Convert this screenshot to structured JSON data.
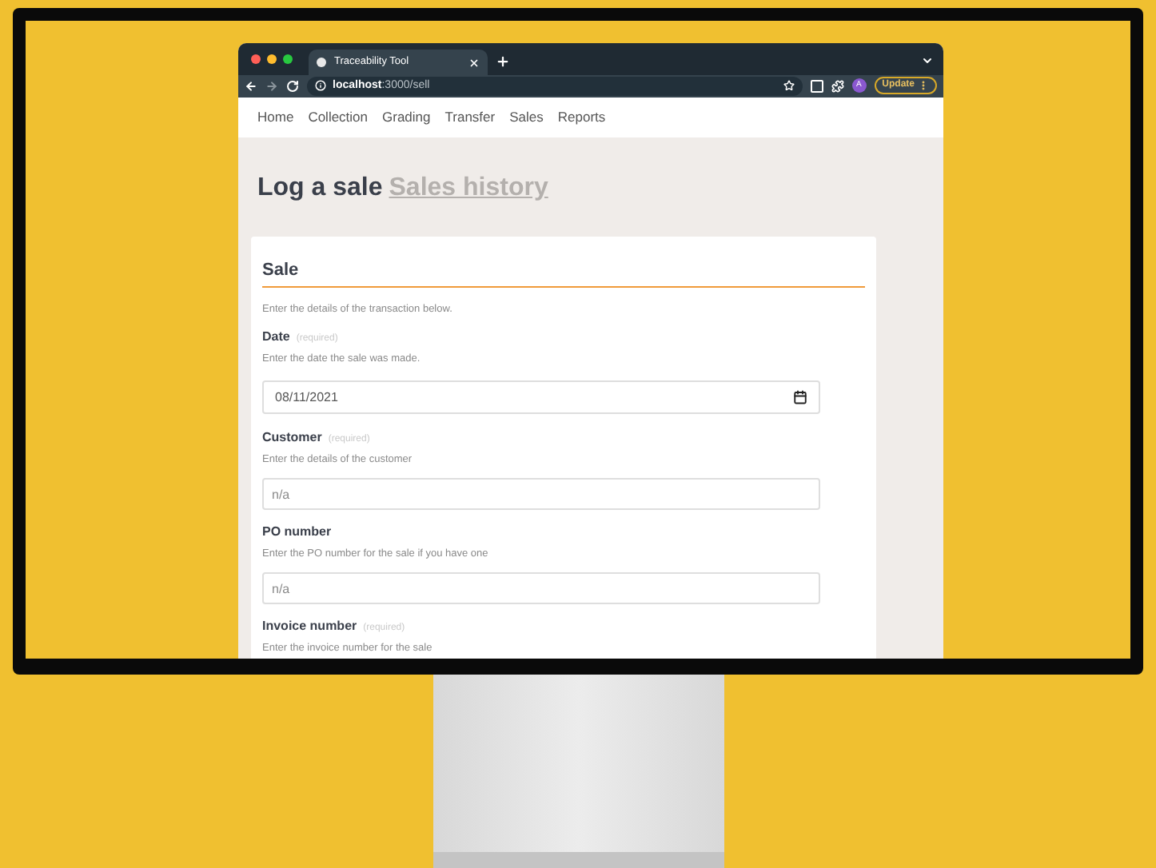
{
  "browser": {
    "tab_title": "Traceability Tool",
    "address_host": "localhost",
    "address_path": ":3000/sell",
    "profile": "A",
    "update_button": "Update"
  },
  "nav": {
    "items": [
      {
        "label": "Home"
      },
      {
        "label": "Collection"
      },
      {
        "label": "Grading"
      },
      {
        "label": "Transfer"
      },
      {
        "label": "Sales"
      },
      {
        "label": "Reports"
      }
    ]
  },
  "page": {
    "title": "Log a sale",
    "link": "Sales history"
  },
  "form": {
    "heading": "Sale",
    "intro": "Enter the details of the transaction below.",
    "fields": [
      {
        "label": "Date",
        "required": "(required)",
        "hint": "Enter the date the sale was made.",
        "kind": "date",
        "value": "08/11/2021"
      },
      {
        "label": "Customer",
        "required": "(required)",
        "hint": "Enter the details of the customer",
        "kind": "text",
        "placeholder": "n/a"
      },
      {
        "label": "PO number",
        "hint": "Enter the PO number for the sale if you have one",
        "kind": "text",
        "placeholder": "n/a"
      },
      {
        "label": "Invoice number",
        "required": "(required)",
        "hint": "Enter the invoice number for the sale"
      }
    ]
  }
}
